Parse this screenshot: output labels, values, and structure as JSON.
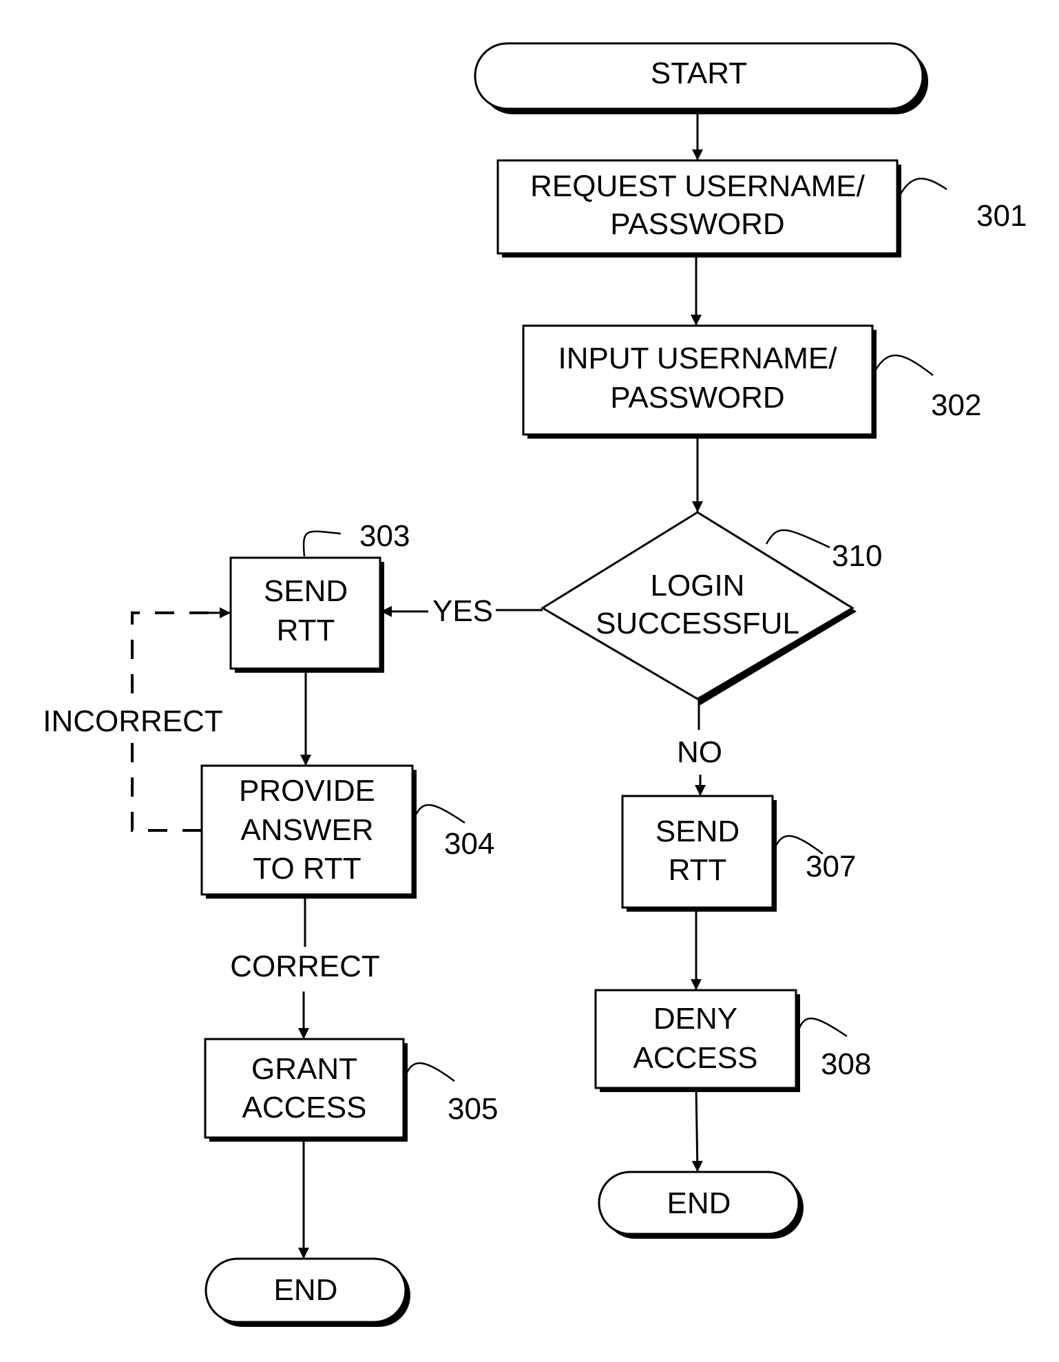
{
  "diagram": {
    "type": "flowchart",
    "nodes": {
      "start": {
        "shape": "terminal",
        "text": "START"
      },
      "n301": {
        "shape": "process",
        "line1": "REQUEST USERNAME/",
        "line2": "PASSWORD",
        "ref": "301"
      },
      "n302": {
        "shape": "process",
        "line1": "INPUT USERNAME/",
        "line2": "PASSWORD",
        "ref": "302"
      },
      "n310": {
        "shape": "decision",
        "line1": "LOGIN",
        "line2": "SUCCESSFUL",
        "ref": "310"
      },
      "n303": {
        "shape": "process",
        "line1": "SEND",
        "line2": "RTT",
        "ref": "303"
      },
      "n304": {
        "shape": "process",
        "line1": "PROVIDE",
        "line2": "ANSWER",
        "line3": "TO RTT",
        "ref": "304"
      },
      "n305": {
        "shape": "process",
        "line1": "GRANT",
        "line2": "ACCESS",
        "ref": "305"
      },
      "end_left": {
        "shape": "terminal",
        "text": "END"
      },
      "n307": {
        "shape": "process",
        "line1": "SEND",
        "line2": "RTT",
        "ref": "307"
      },
      "n308": {
        "shape": "process",
        "line1": "DENY",
        "line2": "ACCESS",
        "ref": "308"
      },
      "end_right": {
        "shape": "terminal",
        "text": "END"
      }
    },
    "edge_labels": {
      "yes": "YES",
      "no": "NO",
      "incorrect": "INCORRECT",
      "correct": "CORRECT"
    },
    "edges": [
      {
        "from": "START",
        "to": "301"
      },
      {
        "from": "301",
        "to": "302"
      },
      {
        "from": "302",
        "to": "310"
      },
      {
        "from": "310",
        "to": "303",
        "label": "YES"
      },
      {
        "from": "310",
        "to": "307",
        "label": "NO"
      },
      {
        "from": "303",
        "to": "304"
      },
      {
        "from": "304",
        "to": "303",
        "label": "INCORRECT",
        "style": "dashed"
      },
      {
        "from": "304",
        "to": "305",
        "label": "CORRECT"
      },
      {
        "from": "305",
        "to": "END"
      },
      {
        "from": "307",
        "to": "308"
      },
      {
        "from": "308",
        "to": "END"
      }
    ]
  }
}
